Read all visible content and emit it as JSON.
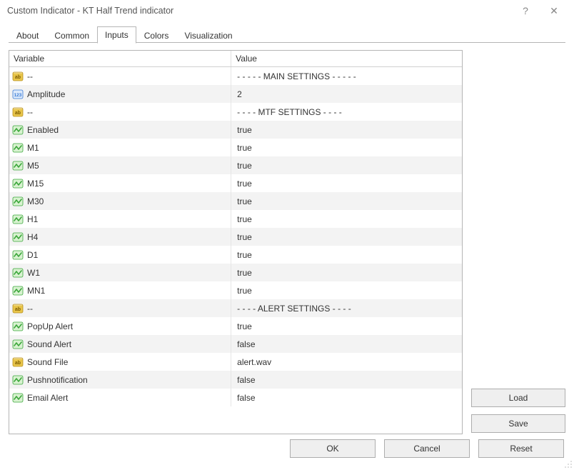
{
  "window": {
    "title": "Custom Indicator - KT Half Trend indicator",
    "help_glyph": "?",
    "close_glyph": "✕"
  },
  "tabs": {
    "about": "About",
    "common": "Common",
    "inputs": "Inputs",
    "colors": "Colors",
    "visualization": "Visualization",
    "active": "inputs"
  },
  "table": {
    "header_variable": "Variable",
    "header_value": "Value",
    "rows": [
      {
        "icon": "string",
        "name": "--",
        "value": "- - - - - MAIN SETTINGS - - - - -"
      },
      {
        "icon": "number",
        "name": "Amplitude",
        "value": "2"
      },
      {
        "icon": "string",
        "name": "--",
        "value": "- - - - MTF SETTINGS - - - -"
      },
      {
        "icon": "bool",
        "name": "Enabled",
        "value": "true"
      },
      {
        "icon": "bool",
        "name": "M1",
        "value": "true"
      },
      {
        "icon": "bool",
        "name": "M5",
        "value": "true"
      },
      {
        "icon": "bool",
        "name": "M15",
        "value": "true"
      },
      {
        "icon": "bool",
        "name": "M30",
        "value": "true"
      },
      {
        "icon": "bool",
        "name": "H1",
        "value": "true"
      },
      {
        "icon": "bool",
        "name": "H4",
        "value": "true"
      },
      {
        "icon": "bool",
        "name": "D1",
        "value": "true"
      },
      {
        "icon": "bool",
        "name": "W1",
        "value": "true"
      },
      {
        "icon": "bool",
        "name": "MN1",
        "value": "true"
      },
      {
        "icon": "string",
        "name": "--",
        "value": "- - - - ALERT SETTINGS - - - -"
      },
      {
        "icon": "bool",
        "name": "PopUp Alert",
        "value": "true"
      },
      {
        "icon": "bool",
        "name": "Sound Alert",
        "value": "false"
      },
      {
        "icon": "string-file",
        "name": "Sound File",
        "value": "alert.wav"
      },
      {
        "icon": "bool",
        "name": "Pushnotification",
        "value": "false"
      },
      {
        "icon": "bool",
        "name": "Email Alert",
        "value": "false"
      }
    ]
  },
  "side_buttons": {
    "load": "Load",
    "save": "Save"
  },
  "footer_buttons": {
    "ok": "OK",
    "cancel": "Cancel",
    "reset": "Reset"
  },
  "icons": {
    "string_color": "#e8c54a",
    "number_color": "#3a7bd5",
    "bool_color": "#3aa63a"
  }
}
